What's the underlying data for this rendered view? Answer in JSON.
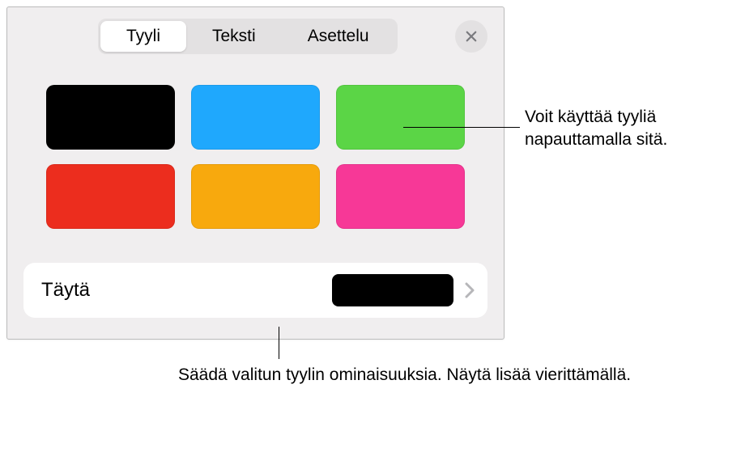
{
  "tabs": {
    "style": "Tyyli",
    "text": "Teksti",
    "layout": "Asettelu"
  },
  "swatches": [
    {
      "name": "black",
      "color": "#000000"
    },
    {
      "name": "blue",
      "color": "#1fa8fd"
    },
    {
      "name": "green",
      "color": "#5bd546"
    },
    {
      "name": "red",
      "color": "#ec2d1e"
    },
    {
      "name": "orange",
      "color": "#f8a90d"
    },
    {
      "name": "pink",
      "color": "#f73897"
    }
  ],
  "fill": {
    "label": "Täytä",
    "color": "#000000"
  },
  "callouts": {
    "apply_style": "Voit käyttää tyyliä napauttamalla sitä.",
    "adjust_style": "Säädä valitun tyylin ominaisuuksia. Näytä lisää vierittämällä."
  }
}
